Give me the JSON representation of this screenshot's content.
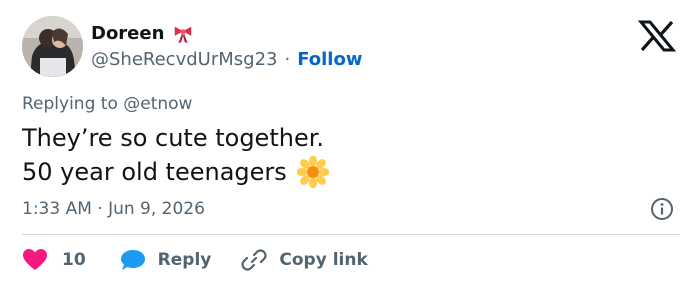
{
  "author": {
    "display_name": "Doreen",
    "name_emoji": "ribbon-emoji",
    "handle": "@SheRecvdUrMsg23",
    "separator": "·",
    "follow_label": "Follow"
  },
  "replying_to": "Replying to @etnow",
  "tweet": {
    "lines": [
      "They’re so cute together.",
      "50 year old teenagers"
    ],
    "trailing_emoji": "blossom-emoji"
  },
  "timestamp": "1:33 AM · Jun 9, 2026",
  "actions": {
    "like_count": "10",
    "reply_label": "Reply",
    "copy_link_label": "Copy link"
  },
  "colors": {
    "like_heart": "#f91880",
    "reply_bubble": "#1d9bf0",
    "follow_link": "#0068c8",
    "secondary_text": "#536471",
    "primary_text": "#0f1419"
  },
  "icons": [
    "x-logo-icon",
    "info-icon",
    "heart-icon",
    "reply-bubble-icon",
    "link-icon"
  ]
}
